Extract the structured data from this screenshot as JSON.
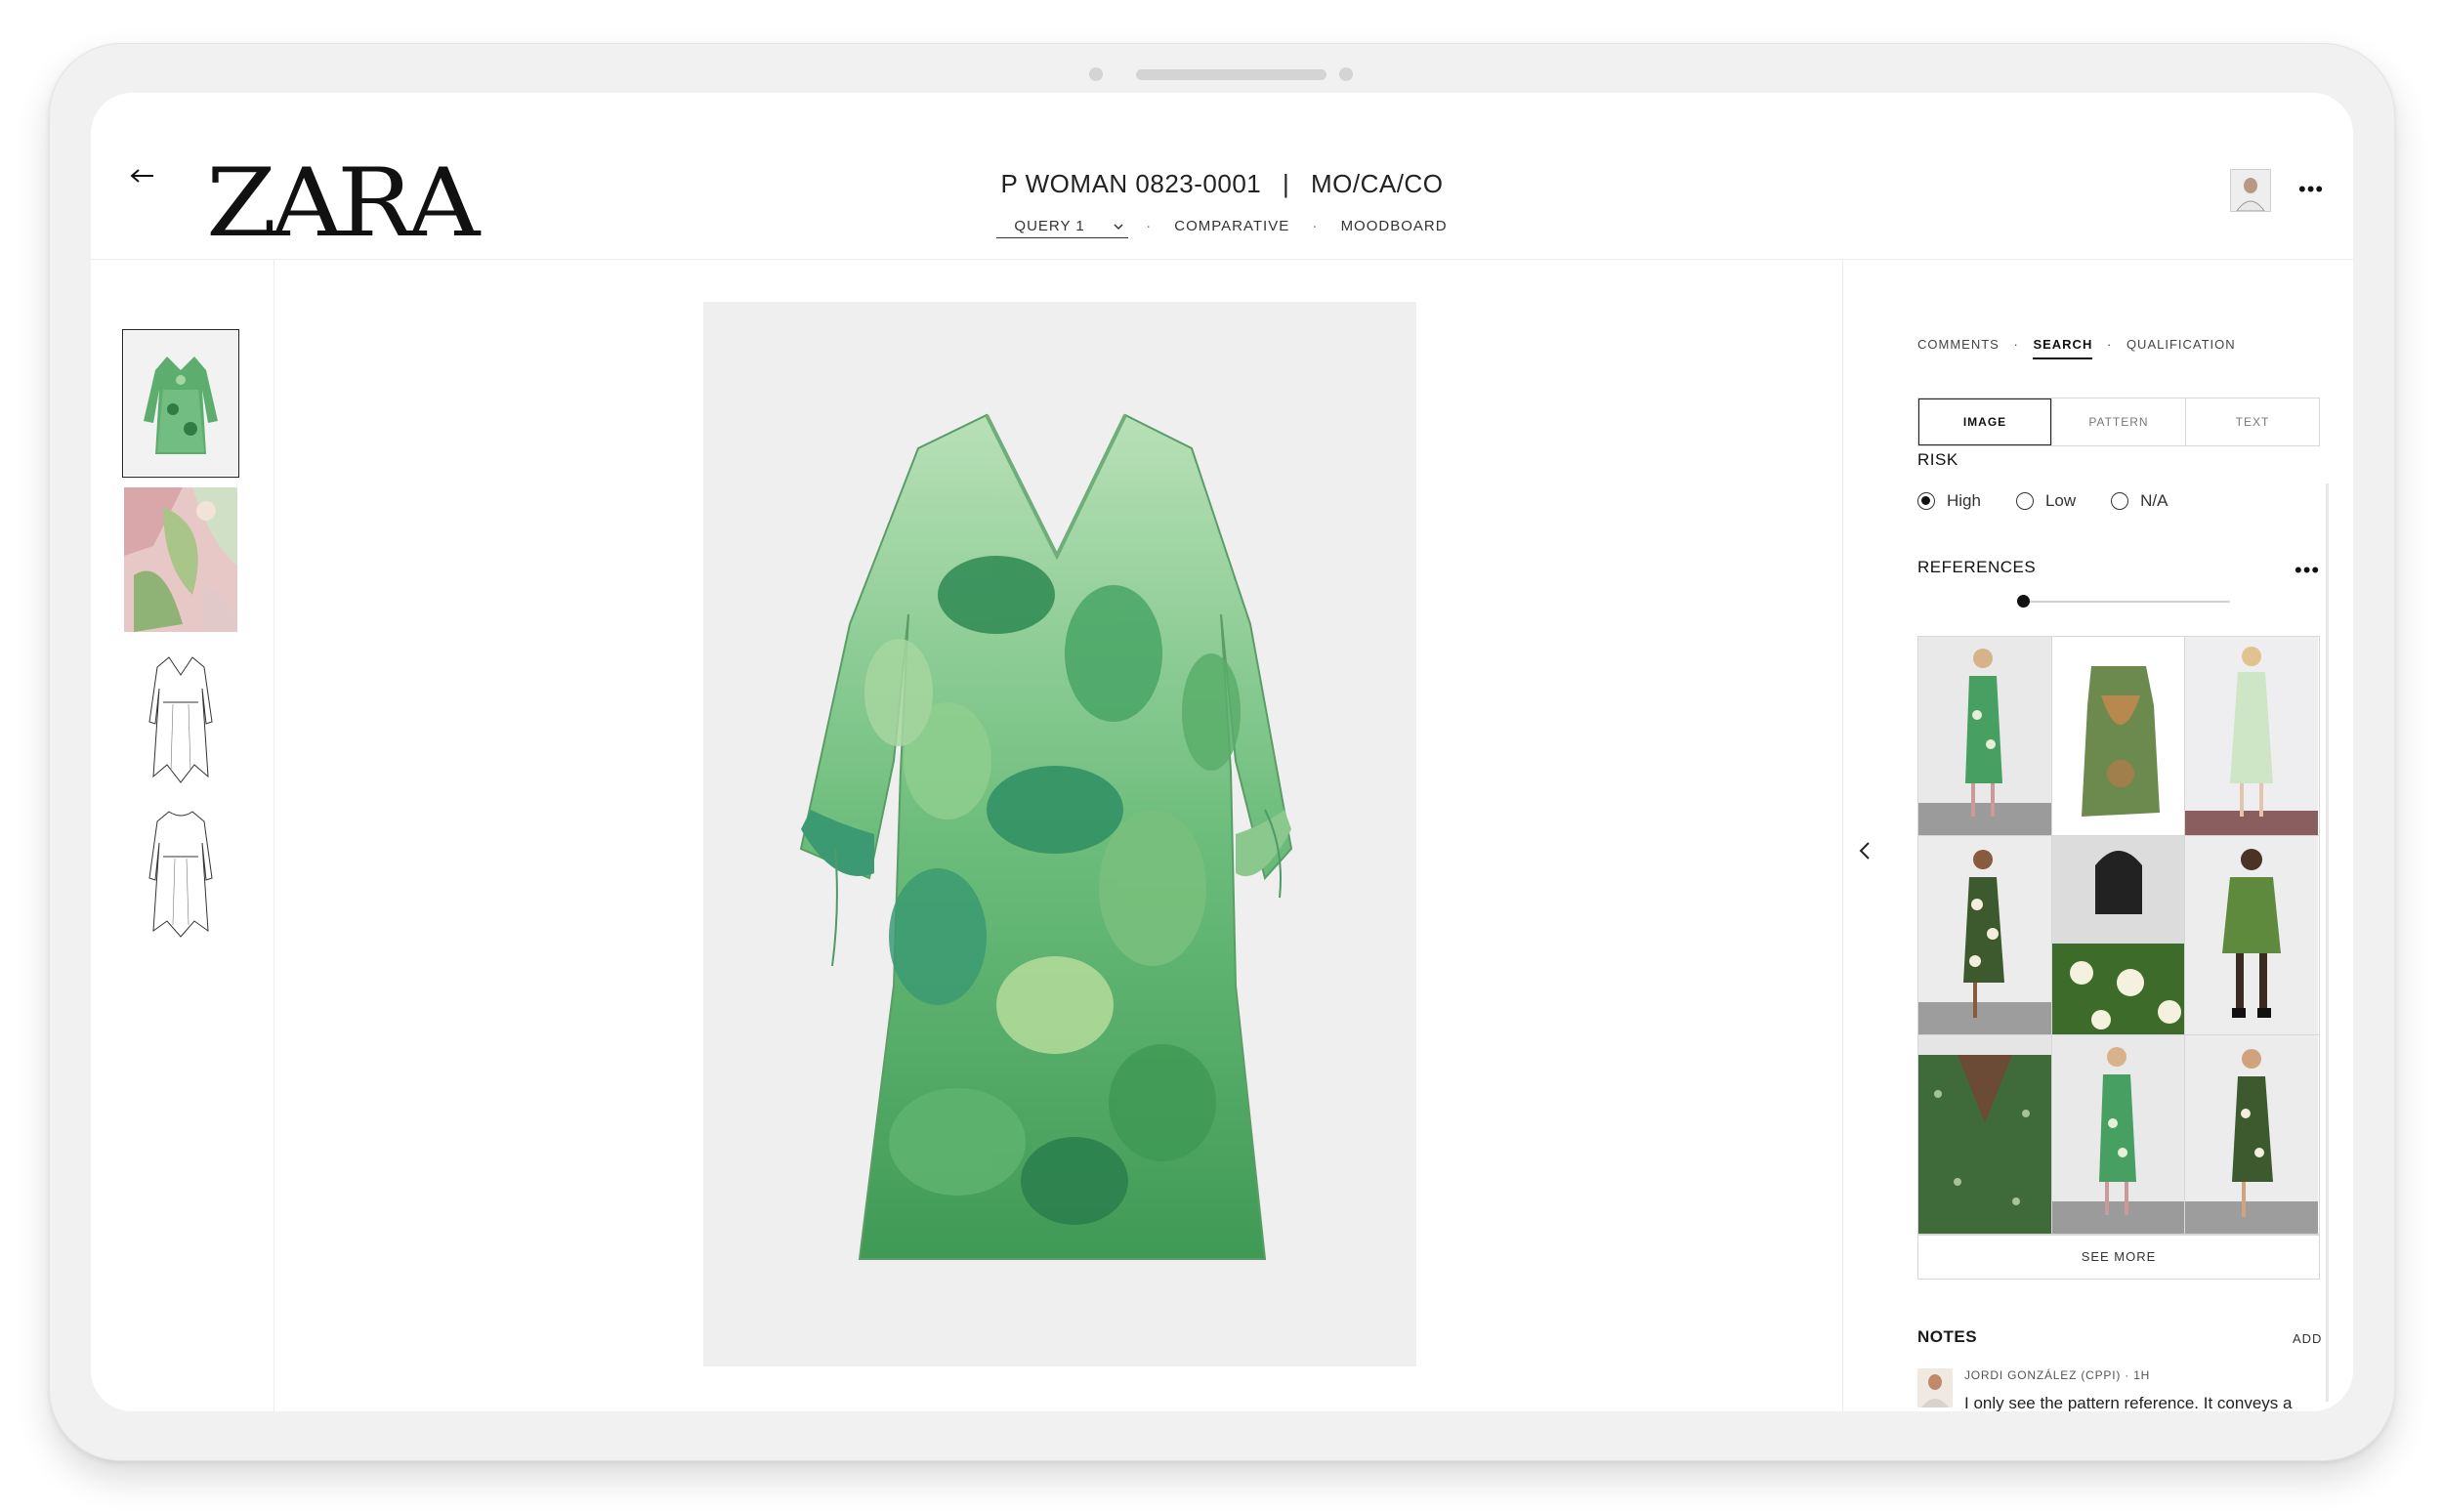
{
  "header": {
    "brand": "ZARA",
    "title_code": "P WOMAN 0823-0001",
    "title_separator": "|",
    "title_category": "MO/CA/CO",
    "nav": {
      "query": "QUERY 1",
      "separator": "·",
      "comparative": "COMPARATIVE",
      "moodboard": "MOODBOARD"
    }
  },
  "right_panel": {
    "tabs": {
      "comments": "COMMENTS",
      "separator": "·",
      "search": "SEARCH",
      "qualification": "QUALIFICATION"
    },
    "search_modes": {
      "image": "IMAGE",
      "pattern": "PATTERN",
      "text": "TEXT"
    },
    "risk": {
      "label": "RISK",
      "options": [
        "High",
        "Low",
        "N/A"
      ],
      "selected": "High"
    },
    "references": {
      "label": "REFERENCES",
      "slider_position": 0.0,
      "see_more": "SEE MORE"
    },
    "notes": {
      "label": "NOTES",
      "add": "ADD",
      "items": [
        {
          "author_meta": "JORDI GONZÁLEZ (CPPI) · 1H",
          "text": "I only see the pattern reference. It conveys a"
        }
      ]
    }
  },
  "icons": {
    "back": "arrow-left-icon",
    "more": "more-horizontal-icon",
    "collapse": "chevron-left-icon",
    "query_dropdown": "chevron-down-icon"
  },
  "colors": {
    "accent": "#111111",
    "divider": "#ececec",
    "border": "#d7d7d7",
    "print_green": "#3f9a55"
  }
}
